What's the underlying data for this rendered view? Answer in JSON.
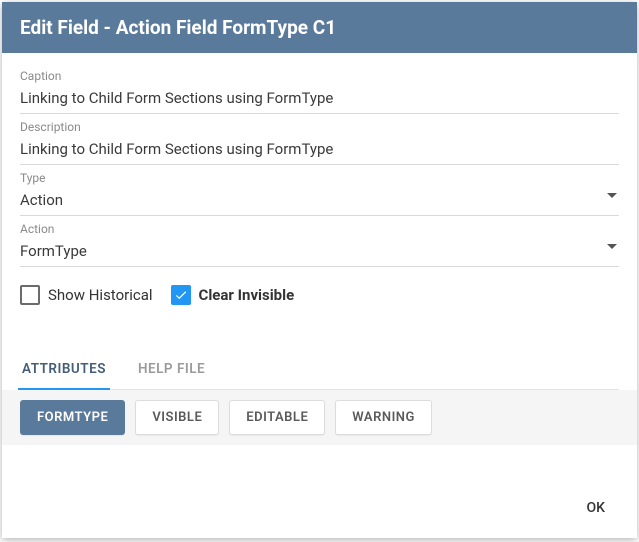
{
  "title": "Edit Field - Action Field FormType C1",
  "fields": {
    "caption": {
      "label": "Caption",
      "value": "Linking to Child Form Sections using FormType"
    },
    "description": {
      "label": "Description",
      "value": "Linking to Child Form Sections using FormType"
    },
    "type": {
      "label": "Type",
      "value": "Action"
    },
    "action": {
      "label": "Action",
      "value": "FormType"
    }
  },
  "checkboxes": {
    "show_historical": {
      "label": "Show Historical",
      "checked": false
    },
    "clear_invisible": {
      "label": "Clear Invisible",
      "checked": true
    }
  },
  "tabs": [
    {
      "id": "attributes",
      "label": "ATTRIBUTES",
      "active": true
    },
    {
      "id": "helpfile",
      "label": "HELP FILE",
      "active": false
    }
  ],
  "chips": [
    {
      "id": "formtype",
      "label": "FORMTYPE",
      "active": true
    },
    {
      "id": "visible",
      "label": "VISIBLE",
      "active": false
    },
    {
      "id": "editable",
      "label": "EDITABLE",
      "active": false
    },
    {
      "id": "warning",
      "label": "WARNING",
      "active": false
    }
  ],
  "footer": {
    "ok": "OK"
  }
}
